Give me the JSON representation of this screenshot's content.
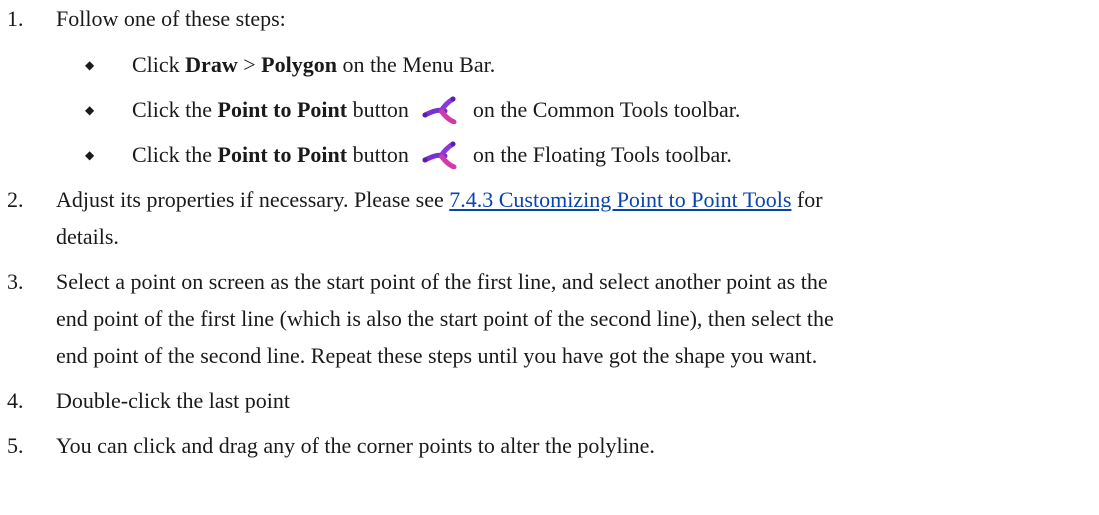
{
  "steps": {
    "s1": {
      "number": "1.",
      "text": "Follow one of these steps:",
      "sub": [
        {
          "pre": "Click ",
          "b1": "Draw",
          "sep": " > ",
          "b2": "Polygon",
          "post": " on the Menu Bar."
        },
        {
          "pre": "Click the ",
          "bold": "Point to Point",
          "mid": " button",
          "icon": "point-to-point-icon",
          "post": "on the Common Tools toolbar."
        },
        {
          "pre": "Click the ",
          "bold": "Point to Point",
          "mid": " button",
          "icon": "point-to-point-icon",
          "post": "on the Floating Tools toolbar."
        }
      ]
    },
    "s2": {
      "number": "2.",
      "pre": "Adjust its properties if necessary. Please see ",
      "link": "7.4.3 Customizing Point to Point Tools",
      "post": " for",
      "cont": "details."
    },
    "s3": {
      "number": "3.",
      "line1": "Select a point on screen as the start point of the first line, and select another point as the",
      "line2": "end point of the first line (which is also the start point of the second line), then select the",
      "line3": "end point of the second line. Repeat these steps until you have got the shape you want."
    },
    "s4": {
      "number": "4.",
      "text": "Double-click the last point"
    },
    "s5": {
      "number": "5.",
      "text": "You can click and drag any of the corner points to alter the polyline."
    }
  },
  "colors": {
    "link": "#0645ad",
    "icon_primary": "#7a2fd0",
    "icon_secondary": "#d23aa8"
  }
}
